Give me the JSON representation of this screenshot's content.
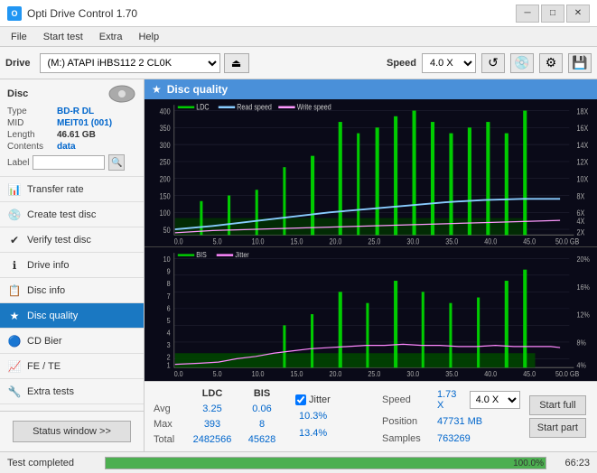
{
  "titleBar": {
    "title": "Opti Drive Control 1.70",
    "minimizeLabel": "─",
    "maximizeLabel": "□",
    "closeLabel": "✕"
  },
  "menuBar": {
    "items": [
      "File",
      "Start test",
      "Extra",
      "Help"
    ]
  },
  "driveBar": {
    "driveLabel": "Drive",
    "driveValue": "(M:) ATAPI iHBS112  2 CL0K",
    "speedLabel": "Speed",
    "speedValue": "4.0 X"
  },
  "disc": {
    "title": "Disc",
    "typeLabel": "Type",
    "typeValue": "BD-R DL",
    "midLabel": "MID",
    "midValue": "MEIT01 (001)",
    "lengthLabel": "Length",
    "lengthValue": "46.61 GB",
    "contentsLabel": "Contents",
    "contentsValue": "data",
    "labelLabel": "Label"
  },
  "nav": {
    "items": [
      {
        "id": "transfer-rate",
        "label": "Transfer rate",
        "icon": "📊"
      },
      {
        "id": "create-test-disc",
        "label": "Create test disc",
        "icon": "💿"
      },
      {
        "id": "verify-test-disc",
        "label": "Verify test disc",
        "icon": "✔"
      },
      {
        "id": "drive-info",
        "label": "Drive info",
        "icon": "ℹ"
      },
      {
        "id": "disc-info",
        "label": "Disc info",
        "icon": "📋"
      },
      {
        "id": "disc-quality",
        "label": "Disc quality",
        "icon": "★",
        "active": true
      },
      {
        "id": "cd-bier",
        "label": "CD Bier",
        "icon": "🔵"
      },
      {
        "id": "fe-te",
        "label": "FE / TE",
        "icon": "📈"
      },
      {
        "id": "extra-tests",
        "label": "Extra tests",
        "icon": "🔧"
      }
    ]
  },
  "discQuality": {
    "title": "Disc quality",
    "chart1": {
      "title": "LDC",
      "legends": [
        {
          "label": "LDC",
          "color": "#00ff00"
        },
        {
          "label": "Read speed",
          "color": "#00aaff"
        },
        {
          "label": "Write speed",
          "color": "#ff44ff"
        }
      ],
      "yAxisRight": [
        "18X",
        "16X",
        "14X",
        "12X",
        "10X",
        "8X",
        "6X",
        "4X",
        "2X"
      ],
      "yAxisLeft": [
        "400",
        "350",
        "300",
        "250",
        "200",
        "150",
        "100",
        "50",
        "0"
      ],
      "xAxis": [
        "0.0",
        "5.0",
        "10.0",
        "15.0",
        "20.0",
        "25.0",
        "30.0",
        "35.0",
        "40.0",
        "45.0",
        "50.0 GB"
      ]
    },
    "chart2": {
      "title": "BIS",
      "legends": [
        {
          "label": "BIS",
          "color": "#00ff00"
        },
        {
          "label": "Jitter",
          "color": "#ff44ff"
        }
      ],
      "yAxisRight": [
        "20%",
        "16%",
        "12%",
        "8%",
        "4%"
      ],
      "yAxisLeft": [
        "10",
        "9",
        "8",
        "7",
        "6",
        "5",
        "4",
        "3",
        "2",
        "1"
      ],
      "xAxis": [
        "0.0",
        "5.0",
        "10.0",
        "15.0",
        "20.0",
        "25.0",
        "30.0",
        "35.0",
        "40.0",
        "45.0",
        "50.0 GB"
      ]
    }
  },
  "stats": {
    "headers": [
      "LDC",
      "BIS",
      "",
      "Jitter",
      "Speed",
      ""
    ],
    "avgLabel": "Avg",
    "avgLdc": "3.25",
    "avgBis": "0.06",
    "avgJitter": "10.3%",
    "avgSpeed": "1.73 X",
    "avgSpeedDrop": "4.0 X",
    "maxLabel": "Max",
    "maxLdc": "393",
    "maxBis": "8",
    "maxJitter": "13.4%",
    "positionLabel": "Position",
    "positionValue": "47731 MB",
    "totalLabel": "Total",
    "totalLdc": "2482566",
    "totalBis": "45628",
    "samplesLabel": "Samples",
    "samplesValue": "763269",
    "startFullLabel": "Start full",
    "startPartLabel": "Start part",
    "jitterChecked": true,
    "jitterLabel": "Jitter"
  },
  "statusBar": {
    "statusText": "Test completed",
    "progressValue": "100.0%",
    "timeValue": "66:23"
  }
}
